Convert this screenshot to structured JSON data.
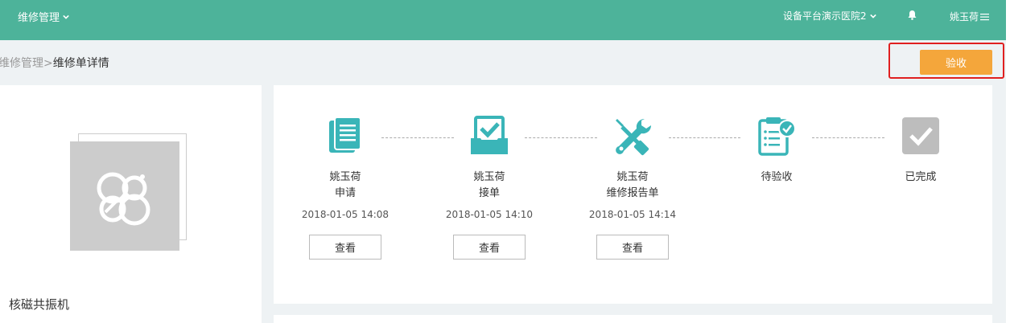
{
  "header": {
    "menu_label": "维修管理",
    "hospital_label": "设备平台演示医院2",
    "user_label": "姚玉荷"
  },
  "breadcrumb": {
    "parent": "维修管理",
    "separator": ">",
    "current": "维修单详情"
  },
  "toolbar": {
    "accept_label": "验收"
  },
  "device": {
    "name": "核磁共振机"
  },
  "progress": {
    "steps": [
      {
        "name": "姚玉荷",
        "action": "申请",
        "time": "2018-01-05 14:08",
        "button": "查看",
        "icon": "document-icon"
      },
      {
        "name": "姚玉荷",
        "action": "接单",
        "time": "2018-01-05 14:10",
        "button": "查看",
        "icon": "inbox-check-icon"
      },
      {
        "name": "姚玉荷",
        "action": "维修报告单",
        "time": "2018-01-05 14:14",
        "button": "查看",
        "icon": "tools-icon"
      },
      {
        "name": "待验收",
        "icon": "clipboard-check-icon"
      },
      {
        "name": "已完成",
        "icon": "checkbox-done-icon"
      }
    ]
  },
  "colors": {
    "header_bg": "#4db39a",
    "accent": "#3ab5b8",
    "accept_button": "#f4a63b",
    "highlight_border": "#e02020",
    "done_gray": "#bdbdbd"
  }
}
